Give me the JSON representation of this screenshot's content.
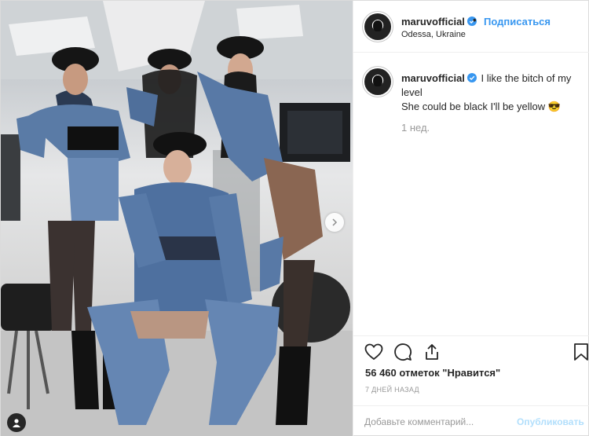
{
  "post": {
    "author": {
      "username": "maruvofficial",
      "verified": true,
      "location": "Odessa, Ukraine"
    },
    "follow_label": "Подписаться",
    "separator": "•",
    "caption": {
      "username": "maruvofficial",
      "line1": "I like the bitch of my level",
      "line2": "She could be black I'll be yellow 😎"
    },
    "time_ago": "1 нед.",
    "likes": "56 460 отметок \"Нравится\"",
    "date": "7 ДНЕЙ НАЗАД",
    "comment": {
      "placeholder": "Добавьте комментарий...",
      "value": "",
      "publish_label": "Опубликовать"
    },
    "icons": {
      "like": "heart-icon",
      "comment": "speech-bubble-icon",
      "share": "share-icon",
      "save": "bookmark-icon",
      "next": "chevron-right-icon",
      "tags": "user-tag-icon",
      "verified": "verified-badge-icon"
    },
    "colors": {
      "link": "#3897f0",
      "publish_disabled": "#b2dffc",
      "secondary_text": "#999999",
      "border": "#efefef"
    }
  }
}
